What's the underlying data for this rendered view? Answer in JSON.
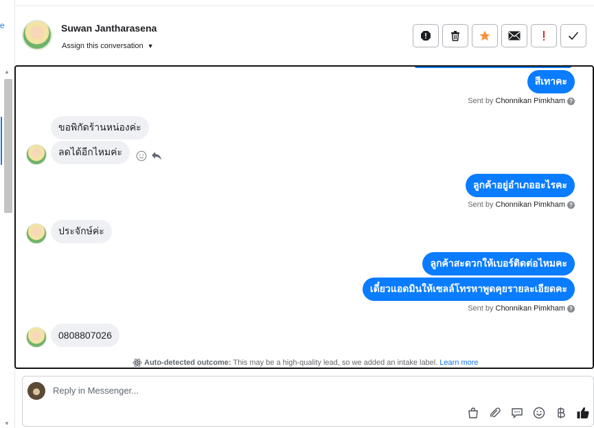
{
  "left_strip": {
    "edge_glyph": "e"
  },
  "header": {
    "name": "Suwan Jantharasena",
    "assign_label": "Assign this conversation"
  },
  "actions": [
    {
      "name": "report-icon"
    },
    {
      "name": "trash-icon"
    },
    {
      "name": "star-icon"
    },
    {
      "name": "mail-icon"
    },
    {
      "name": "exclamation-icon"
    },
    {
      "name": "check-icon"
    }
  ],
  "messages": {
    "out1": "สีเทาคะ",
    "sent1": {
      "prefix": "Sent by",
      "who": "Chonnikan Pimkham"
    },
    "in1": "ขอพิกัดร้านหน่องค่ะ",
    "in2": "ลดได้อีกไหมค่ะ",
    "out2": "ลูกค้าอยู่อำเภออะไรคะ",
    "sent2": {
      "prefix": "Sent by",
      "who": "Chonnikan Pimkham"
    },
    "in3": "ประจักษ์ค่ะ",
    "out3": "ลูกค้าสะดวกให้เบอร์ติดต่อไหมคะ",
    "out4": "เดี๋ยวแอดมินให้เซลล์โทรหาพูดคุยรายละเอียดคะ",
    "sent3": {
      "prefix": "Sent by",
      "who": "Chonnikan Pimkham"
    },
    "in4": "0808807026"
  },
  "outcome": {
    "bold": "Auto-detected outcome:",
    "text": "This may be a high-quality lead, so we added an intake label.",
    "link": "Learn more"
  },
  "reply": {
    "placeholder": "Reply in Messenger..."
  },
  "colors": {
    "accent_blue": "#0a7cff",
    "star_orange": "#f7923a",
    "alert_red": "#e02020"
  }
}
